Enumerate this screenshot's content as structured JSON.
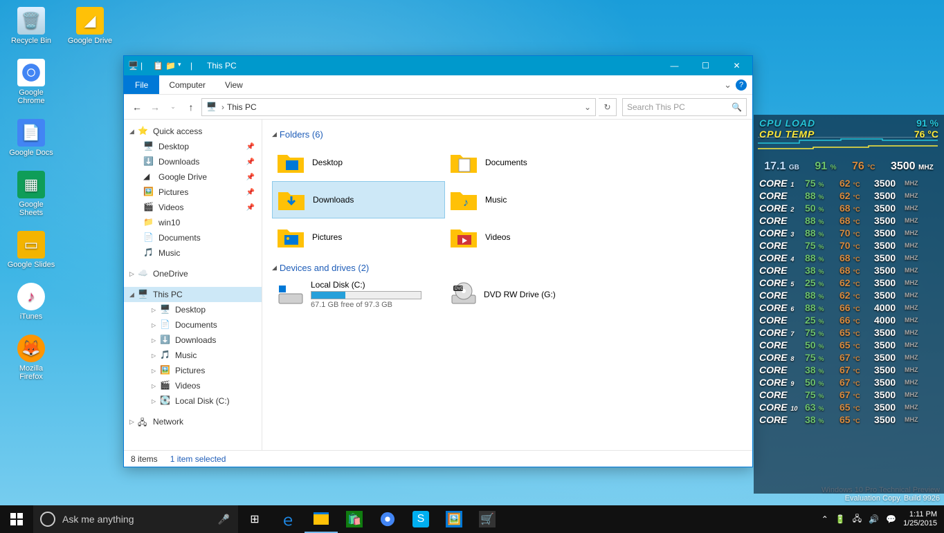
{
  "desktop_icons": {
    "row1": [
      "Recycle Bin",
      "Google Drive"
    ],
    "col": [
      "Google Chrome",
      "Google Docs",
      "Google Sheets",
      "Google Slides",
      "iTunes",
      "Mozilla Firefox"
    ]
  },
  "explorer": {
    "title": "This PC",
    "ribbon": {
      "file": "File",
      "tabs": [
        "Computer",
        "View"
      ]
    },
    "address": {
      "location": "This PC"
    },
    "search": {
      "placeholder": "Search This PC"
    },
    "nav": {
      "quick_access": "Quick access",
      "qa_items": [
        "Desktop",
        "Downloads",
        "Google Drive",
        "Pictures",
        "Videos",
        "win10",
        "Documents",
        "Music"
      ],
      "onedrive": "OneDrive",
      "this_pc": "This PC",
      "pc_items": [
        "Desktop",
        "Documents",
        "Downloads",
        "Music",
        "Pictures",
        "Videos",
        "Local Disk (C:)"
      ],
      "network": "Network"
    },
    "content": {
      "folders_hdr": "Folders (6)",
      "folders": [
        "Desktop",
        "Documents",
        "Downloads",
        "Music",
        "Pictures",
        "Videos"
      ],
      "drives_hdr": "Devices and drives (2)",
      "local_disk": {
        "name": "Local Disk (C:)",
        "free": "67.1 GB free of 97.3 GB",
        "pct": 31
      },
      "dvd": {
        "name": "DVD RW Drive (G:)"
      }
    },
    "status": {
      "items": "8 items",
      "selected": "1 item selected"
    }
  },
  "monitor": {
    "cpu_load_lbl": "CPU LOAD",
    "cpu_load_val": "91 %",
    "cpu_temp_lbl": "CPU TEMP",
    "cpu_temp_val": "76 °C",
    "summary": {
      "gb": "17.1",
      "gb_u": "GB",
      "pct": "91",
      "pct_u": "%",
      "tmp": "76",
      "tmp_u": "°C",
      "mhz": "3500",
      "mhz_u": "MHZ"
    },
    "cores": [
      {
        "n": "1",
        "p": "75",
        "t": "62",
        "m": "3500"
      },
      {
        "n": "",
        "p": "88",
        "t": "62",
        "m": "3500"
      },
      {
        "n": "2",
        "p": "50",
        "t": "68",
        "m": "3500"
      },
      {
        "n": "",
        "p": "88",
        "t": "68",
        "m": "3500"
      },
      {
        "n": "3",
        "p": "88",
        "t": "70",
        "m": "3500"
      },
      {
        "n": "",
        "p": "75",
        "t": "70",
        "m": "3500"
      },
      {
        "n": "4",
        "p": "88",
        "t": "68",
        "m": "3500"
      },
      {
        "n": "",
        "p": "38",
        "t": "68",
        "m": "3500"
      },
      {
        "n": "5",
        "p": "25",
        "t": "62",
        "m": "3500"
      },
      {
        "n": "",
        "p": "88",
        "t": "62",
        "m": "3500"
      },
      {
        "n": "6",
        "p": "88",
        "t": "66",
        "m": "4000"
      },
      {
        "n": "",
        "p": "25",
        "t": "66",
        "m": "4000"
      },
      {
        "n": "7",
        "p": "75",
        "t": "65",
        "m": "3500"
      },
      {
        "n": "",
        "p": "50",
        "t": "65",
        "m": "3500"
      },
      {
        "n": "8",
        "p": "75",
        "t": "67",
        "m": "3500"
      },
      {
        "n": "",
        "p": "38",
        "t": "67",
        "m": "3500"
      },
      {
        "n": "9",
        "p": "50",
        "t": "67",
        "m": "3500"
      },
      {
        "n": "",
        "p": "75",
        "t": "67",
        "m": "3500"
      },
      {
        "n": "10",
        "p": "63",
        "t": "65",
        "m": "3500"
      },
      {
        "n": "",
        "p": "38",
        "t": "65",
        "m": "3500"
      }
    ]
  },
  "watermark": {
    "l1": "Windows 10 Pro Technical Preview",
    "l2": "Evaluation Copy. Build 9926"
  },
  "taskbar": {
    "cortana": "Ask me anything",
    "time": "1:11 PM",
    "date": "1/25/2015"
  }
}
